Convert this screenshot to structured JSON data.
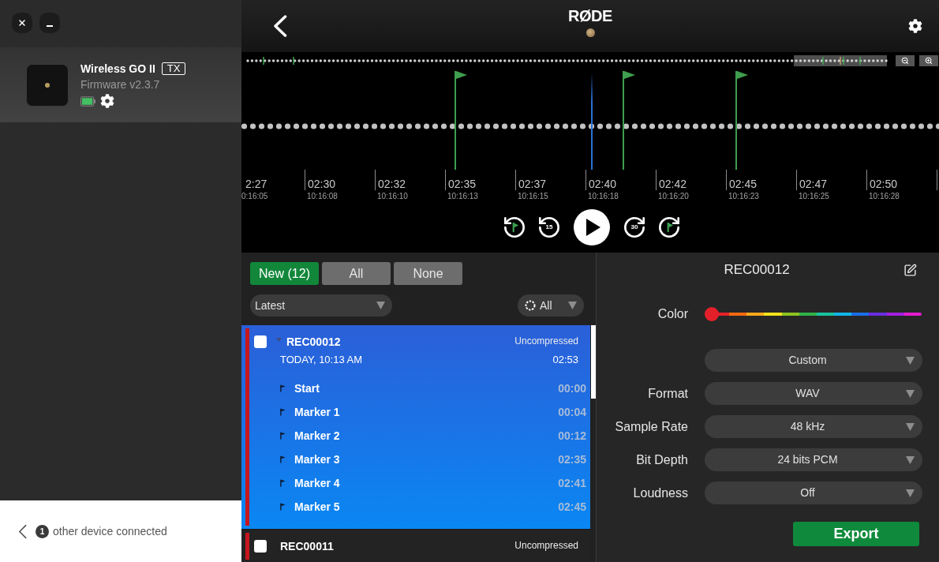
{
  "device": {
    "name": "Wireless GO II",
    "badge": "TX",
    "firmware": "Firmware v2.3.7"
  },
  "other_devices": {
    "count": "1",
    "label": "other device connected"
  },
  "header": {
    "logo": "RØDE"
  },
  "timeline": {
    "ticks": [
      {
        "time": "2:27",
        "clock": "0:16:05"
      },
      {
        "time": "02:30",
        "clock": "10:16:08"
      },
      {
        "time": "02:32",
        "clock": "10:16:10"
      },
      {
        "time": "02:35",
        "clock": "10:16:13"
      },
      {
        "time": "02:37",
        "clock": "10:16:15"
      },
      {
        "time": "02:40",
        "clock": "10:16:18"
      },
      {
        "time": "02:42",
        "clock": "10:16:20"
      },
      {
        "time": "02:45",
        "clock": "10:16:23"
      },
      {
        "time": "02:47",
        "clock": "10:16:25"
      },
      {
        "time": "02:50",
        "clock": "10:16:28"
      }
    ]
  },
  "player": {
    "playing": false,
    "skip_back": "15",
    "skip_forward": "30"
  },
  "filters": [
    {
      "label": "New (12)",
      "selected": true
    },
    {
      "label": "All",
      "selected": false
    },
    {
      "label": "None",
      "selected": false
    }
  ],
  "sort": {
    "value": "Latest"
  },
  "color_filter": {
    "value": "All"
  },
  "recordings": [
    {
      "name": "REC00012",
      "color": "#c8161d",
      "selected": true,
      "checked": false,
      "expanded": true,
      "type": "Uncompressed",
      "date": "TODAY, 10:13 AM",
      "duration": "02:53",
      "markers": [
        {
          "name": "Start",
          "time": "00:00"
        },
        {
          "name": "Marker 1",
          "time": "00:04"
        },
        {
          "name": "Marker 2",
          "time": "00:12"
        },
        {
          "name": "Marker 3",
          "time": "02:35"
        },
        {
          "name": "Marker 4",
          "time": "02:41"
        },
        {
          "name": "Marker 5",
          "time": "02:45"
        }
      ]
    },
    {
      "name": "REC00011",
      "color": "#c8161d",
      "selected": false,
      "checked": false,
      "expanded": false,
      "type": "Uncompressed"
    }
  ],
  "details": {
    "title": "REC00012",
    "color_label": "Color",
    "color": {
      "level": 0
    },
    "preset": "Custom",
    "settings": [
      {
        "label": "Format",
        "value": "WAV"
      },
      {
        "label": "Sample Rate",
        "value": "48 kHz"
      },
      {
        "label": "Bit Depth",
        "value": "24 bits PCM"
      },
      {
        "label": "Loudness",
        "value": "Off"
      }
    ],
    "export": "Export"
  }
}
